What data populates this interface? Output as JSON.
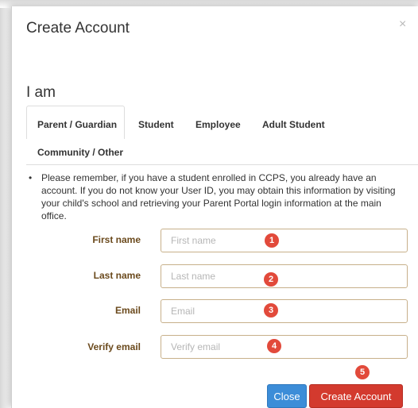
{
  "modal": {
    "title": "Create Account",
    "close_glyph": "×",
    "close_icon": "close-icon"
  },
  "role_prompt": "I am",
  "tabs": [
    {
      "label": "Parent / Guardian",
      "active": true
    },
    {
      "label": "Student",
      "active": false
    },
    {
      "label": "Employee",
      "active": false
    },
    {
      "label": "Adult Student",
      "active": false
    },
    {
      "label": "Community / Other",
      "active": false
    }
  ],
  "notice": {
    "bullet": "•",
    "text": "Please remember, if you have a student enrolled in CCPS, you already have an account. If you do not know your User ID, you may obtain this information by visiting your child's school and retrieving your Parent Portal login information at the main office."
  },
  "form": {
    "fields": [
      {
        "label": "First name",
        "placeholder": "First name",
        "value": "",
        "badge": "1"
      },
      {
        "label": "Last name",
        "placeholder": "Last name",
        "value": "",
        "badge": "2"
      },
      {
        "label": "Email",
        "placeholder": "Email",
        "value": "",
        "badge": "3"
      },
      {
        "label": "Verify email",
        "placeholder": "Verify email",
        "value": "",
        "badge": "4"
      }
    ]
  },
  "buttons": {
    "close_label": "Close",
    "create_label": "Create Account",
    "create_badge": "5"
  },
  "colors": {
    "label_brown": "#6b4a1d",
    "input_border": "#c7b08a",
    "badge_red": "#e24a3b",
    "close_blue": "#3c8dd8",
    "create_red": "#d33a2e"
  }
}
